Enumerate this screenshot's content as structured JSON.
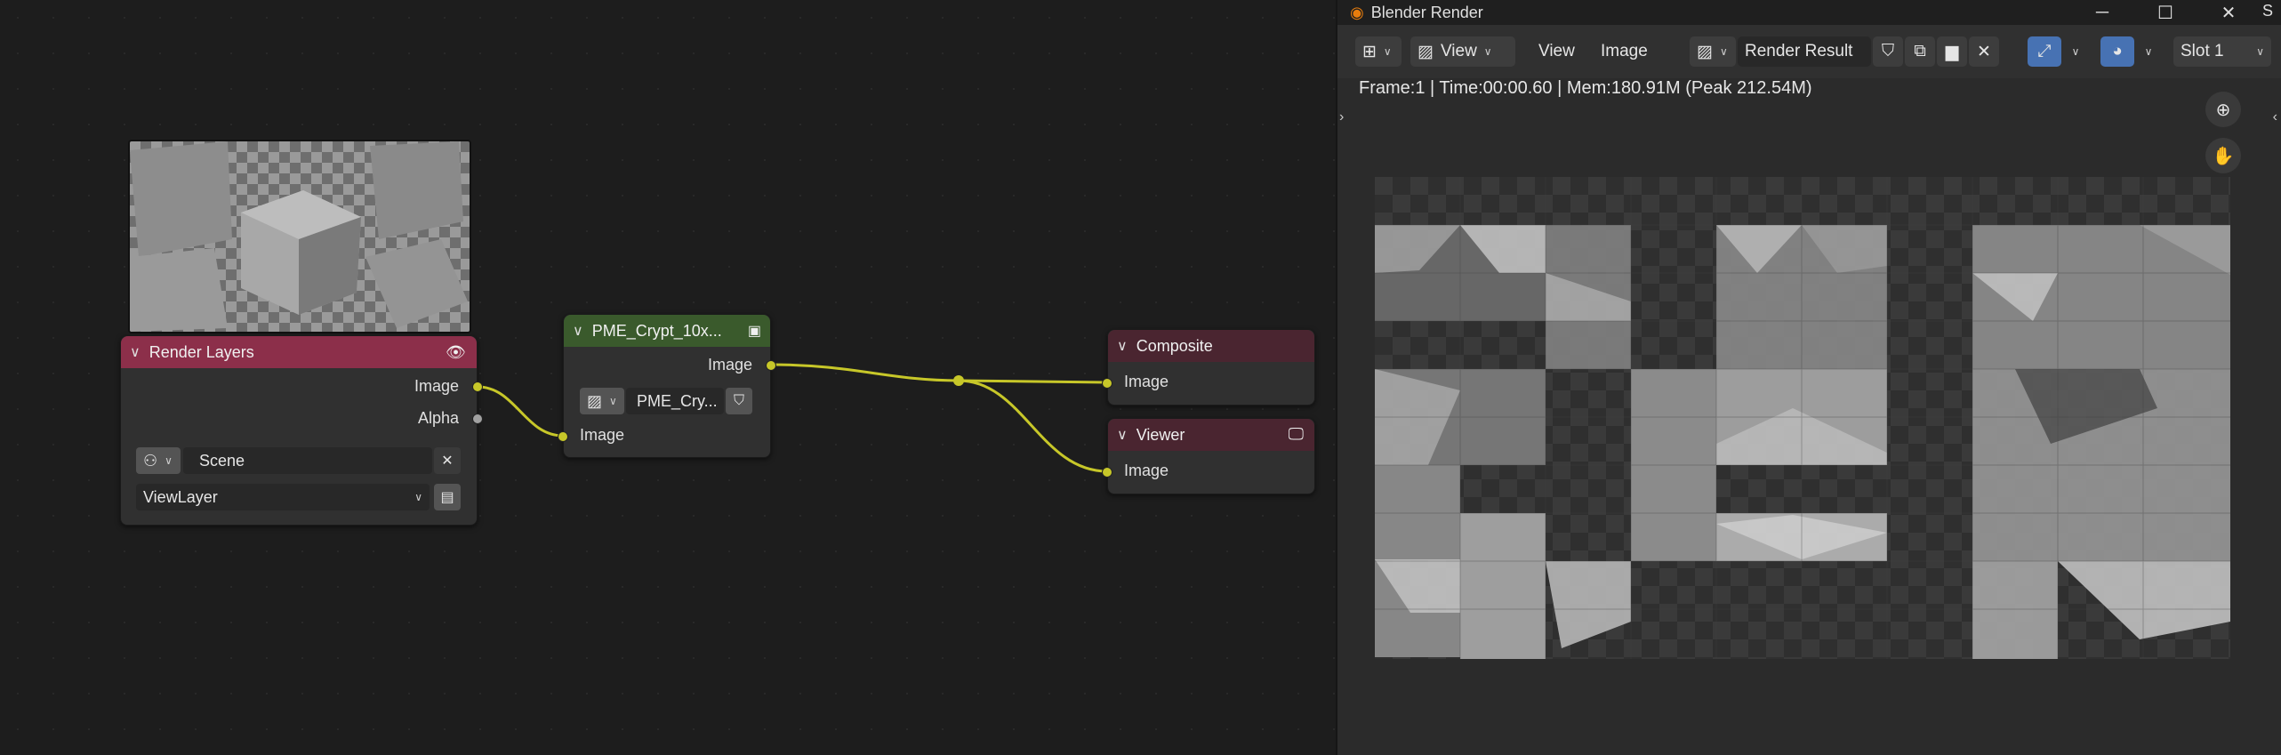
{
  "node_editor": {
    "render_layers": {
      "title": "Render Layers",
      "outputs": [
        "Image",
        "Alpha"
      ],
      "scene": "Scene",
      "view_layer": "ViewLayer"
    },
    "crypt_node": {
      "title": "PME_Crypt_10x...",
      "output": "Image",
      "image_name": "PME_Cry...",
      "input": "Image"
    },
    "composite": {
      "title": "Composite",
      "input": "Image"
    },
    "viewer": {
      "title": "Viewer",
      "input": "Image"
    }
  },
  "render_window": {
    "title": "Blender Render",
    "menus": {
      "view_mode": "View",
      "view": "View",
      "image": "Image"
    },
    "image_name": "Render Result",
    "slot": "Slot 1",
    "info": "Frame:1 | Time:00:00.60 | Mem:180.91M (Peak 212.54M)",
    "partial_label": "S"
  },
  "colors": {
    "render_layers_header": "#8c2f4a",
    "crypt_header": "#3a5a2c",
    "output_header": "#4a2530",
    "link": "#c7c729",
    "accent_blue": "#4772b3"
  },
  "icons": [
    "eye-icon",
    "close-icon",
    "browse-icon",
    "image-icon",
    "shield-icon",
    "monitor-icon",
    "zoom-icon",
    "hand-icon",
    "minimize-icon",
    "maximize-icon",
    "close-window-icon"
  ]
}
